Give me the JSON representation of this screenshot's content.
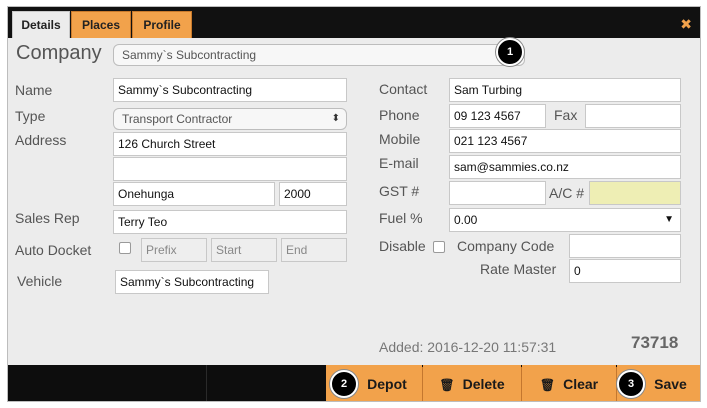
{
  "tabs": [
    {
      "label": "Details",
      "active": true
    },
    {
      "label": "Places",
      "active": false
    },
    {
      "label": "Profile",
      "active": false
    }
  ],
  "close_icon": "✖",
  "company": {
    "label": "Company",
    "value": "Sammy`s Subcontracting"
  },
  "left": {
    "name": {
      "label": "Name",
      "value": "Sammy`s Subcontracting"
    },
    "type": {
      "label": "Type",
      "value": "Transport Contractor"
    },
    "address": {
      "label": "Address",
      "line1": "126 Church Street",
      "line2": "",
      "suburb": "Onehunga",
      "postcode": "2000"
    },
    "sales_rep": {
      "label": "Sales Rep",
      "value": "Terry Teo"
    },
    "auto_docket": {
      "label": "Auto Docket",
      "prefix_placeholder": "Prefix",
      "start_placeholder": "Start",
      "end_placeholder": "End"
    },
    "vehicle": {
      "label": "Vehicle",
      "value": "Sammy`s Subcontracting"
    }
  },
  "right": {
    "contact": {
      "label": "Contact",
      "value": "Sam Turbing"
    },
    "phone": {
      "label": "Phone",
      "value": "09 123 4567"
    },
    "fax": {
      "label": "Fax",
      "value": ""
    },
    "mobile": {
      "label": "Mobile",
      "value": "021 123 4567"
    },
    "email": {
      "label": "E-mail",
      "value": "sam@sammies.co.nz"
    },
    "gst": {
      "label": "GST #",
      "value": ""
    },
    "ac": {
      "label": "A/C #",
      "value": ""
    },
    "fuel": {
      "label": "Fuel %",
      "value": "0.00"
    },
    "disable": {
      "label": "Disable"
    },
    "company_code": {
      "label": "Company Code",
      "value": ""
    },
    "rate_master": {
      "label": "Rate Master",
      "value": "0"
    }
  },
  "added": "Added: 2016-12-20 11:57:31",
  "record_id": "73718",
  "badges": [
    "1",
    "2",
    "3"
  ],
  "footer": {
    "depot_label": "Depot",
    "delete_label": "Delete",
    "clear_label": "Clear",
    "save_label": "Save"
  },
  "colors": {
    "accent": "#f2a24b",
    "footer": "#0d0d0d",
    "panel": "#ececec"
  }
}
